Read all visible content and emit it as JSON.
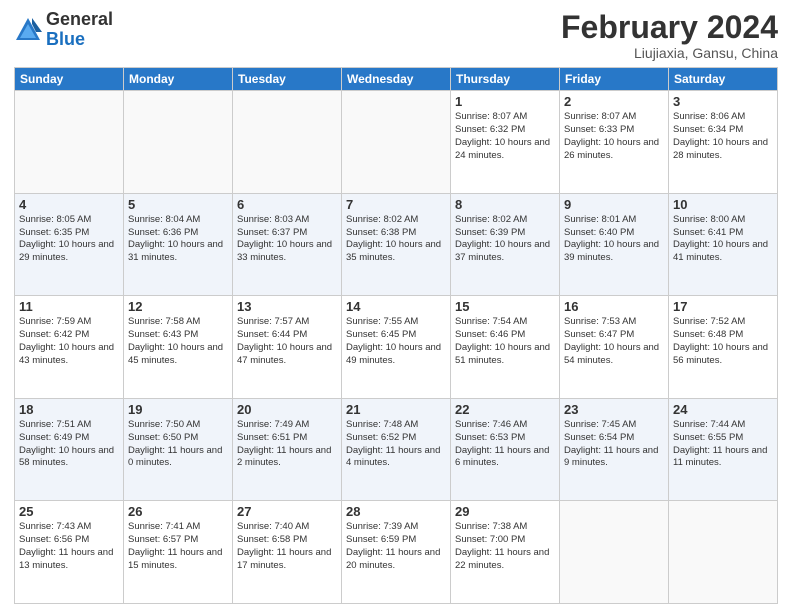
{
  "header": {
    "logo_general": "General",
    "logo_blue": "Blue",
    "title": "February 2024",
    "location": "Liujiaxia, Gansu, China"
  },
  "days_of_week": [
    "Sunday",
    "Monday",
    "Tuesday",
    "Wednesday",
    "Thursday",
    "Friday",
    "Saturday"
  ],
  "weeks": [
    {
      "days": [
        {
          "num": "",
          "info": ""
        },
        {
          "num": "",
          "info": ""
        },
        {
          "num": "",
          "info": ""
        },
        {
          "num": "",
          "info": ""
        },
        {
          "num": "1",
          "info": "Sunrise: 8:07 AM\nSunset: 6:32 PM\nDaylight: 10 hours\nand 24 minutes."
        },
        {
          "num": "2",
          "info": "Sunrise: 8:07 AM\nSunset: 6:33 PM\nDaylight: 10 hours\nand 26 minutes."
        },
        {
          "num": "3",
          "info": "Sunrise: 8:06 AM\nSunset: 6:34 PM\nDaylight: 10 hours\nand 28 minutes."
        }
      ]
    },
    {
      "days": [
        {
          "num": "4",
          "info": "Sunrise: 8:05 AM\nSunset: 6:35 PM\nDaylight: 10 hours\nand 29 minutes."
        },
        {
          "num": "5",
          "info": "Sunrise: 8:04 AM\nSunset: 6:36 PM\nDaylight: 10 hours\nand 31 minutes."
        },
        {
          "num": "6",
          "info": "Sunrise: 8:03 AM\nSunset: 6:37 PM\nDaylight: 10 hours\nand 33 minutes."
        },
        {
          "num": "7",
          "info": "Sunrise: 8:02 AM\nSunset: 6:38 PM\nDaylight: 10 hours\nand 35 minutes."
        },
        {
          "num": "8",
          "info": "Sunrise: 8:02 AM\nSunset: 6:39 PM\nDaylight: 10 hours\nand 37 minutes."
        },
        {
          "num": "9",
          "info": "Sunrise: 8:01 AM\nSunset: 6:40 PM\nDaylight: 10 hours\nand 39 minutes."
        },
        {
          "num": "10",
          "info": "Sunrise: 8:00 AM\nSunset: 6:41 PM\nDaylight: 10 hours\nand 41 minutes."
        }
      ]
    },
    {
      "days": [
        {
          "num": "11",
          "info": "Sunrise: 7:59 AM\nSunset: 6:42 PM\nDaylight: 10 hours\nand 43 minutes."
        },
        {
          "num": "12",
          "info": "Sunrise: 7:58 AM\nSunset: 6:43 PM\nDaylight: 10 hours\nand 45 minutes."
        },
        {
          "num": "13",
          "info": "Sunrise: 7:57 AM\nSunset: 6:44 PM\nDaylight: 10 hours\nand 47 minutes."
        },
        {
          "num": "14",
          "info": "Sunrise: 7:55 AM\nSunset: 6:45 PM\nDaylight: 10 hours\nand 49 minutes."
        },
        {
          "num": "15",
          "info": "Sunrise: 7:54 AM\nSunset: 6:46 PM\nDaylight: 10 hours\nand 51 minutes."
        },
        {
          "num": "16",
          "info": "Sunrise: 7:53 AM\nSunset: 6:47 PM\nDaylight: 10 hours\nand 54 minutes."
        },
        {
          "num": "17",
          "info": "Sunrise: 7:52 AM\nSunset: 6:48 PM\nDaylight: 10 hours\nand 56 minutes."
        }
      ]
    },
    {
      "days": [
        {
          "num": "18",
          "info": "Sunrise: 7:51 AM\nSunset: 6:49 PM\nDaylight: 10 hours\nand 58 minutes."
        },
        {
          "num": "19",
          "info": "Sunrise: 7:50 AM\nSunset: 6:50 PM\nDaylight: 11 hours\nand 0 minutes."
        },
        {
          "num": "20",
          "info": "Sunrise: 7:49 AM\nSunset: 6:51 PM\nDaylight: 11 hours\nand 2 minutes."
        },
        {
          "num": "21",
          "info": "Sunrise: 7:48 AM\nSunset: 6:52 PM\nDaylight: 11 hours\nand 4 minutes."
        },
        {
          "num": "22",
          "info": "Sunrise: 7:46 AM\nSunset: 6:53 PM\nDaylight: 11 hours\nand 6 minutes."
        },
        {
          "num": "23",
          "info": "Sunrise: 7:45 AM\nSunset: 6:54 PM\nDaylight: 11 hours\nand 9 minutes."
        },
        {
          "num": "24",
          "info": "Sunrise: 7:44 AM\nSunset: 6:55 PM\nDaylight: 11 hours\nand 11 minutes."
        }
      ]
    },
    {
      "days": [
        {
          "num": "25",
          "info": "Sunrise: 7:43 AM\nSunset: 6:56 PM\nDaylight: 11 hours\nand 13 minutes."
        },
        {
          "num": "26",
          "info": "Sunrise: 7:41 AM\nSunset: 6:57 PM\nDaylight: 11 hours\nand 15 minutes."
        },
        {
          "num": "27",
          "info": "Sunrise: 7:40 AM\nSunset: 6:58 PM\nDaylight: 11 hours\nand 17 minutes."
        },
        {
          "num": "28",
          "info": "Sunrise: 7:39 AM\nSunset: 6:59 PM\nDaylight: 11 hours\nand 20 minutes."
        },
        {
          "num": "29",
          "info": "Sunrise: 7:38 AM\nSunset: 7:00 PM\nDaylight: 11 hours\nand 22 minutes."
        },
        {
          "num": "",
          "info": ""
        },
        {
          "num": "",
          "info": ""
        }
      ]
    }
  ]
}
